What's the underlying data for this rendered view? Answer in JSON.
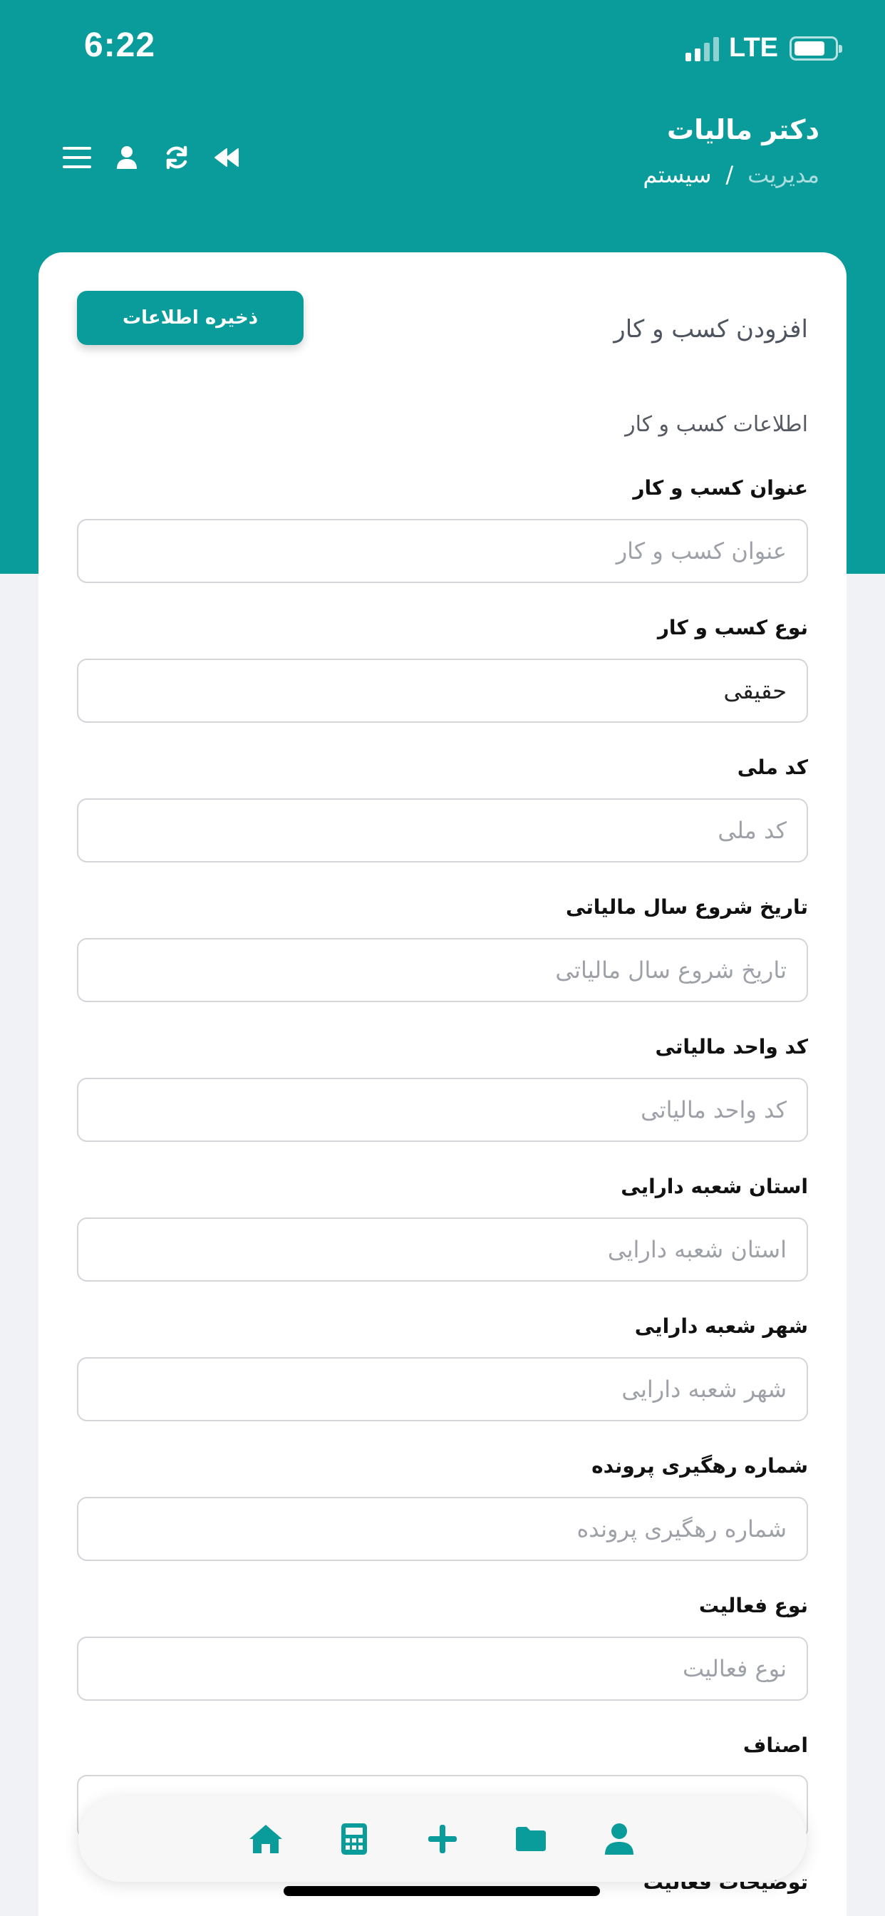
{
  "status_bar": {
    "time": "6:22",
    "network": "LTE"
  },
  "header": {
    "title": "دکتر مالیات",
    "breadcrumb": [
      "مدیریت",
      "سیستم"
    ],
    "breadcrumb_separator": "/"
  },
  "colors": {
    "accent": "#0a9b9b",
    "background": "#f1f2f5"
  },
  "form": {
    "title": "افزودن کسب و کار",
    "save_label": "ذخیره اطلاعات",
    "section_title": "اطلاعات کسب و کار",
    "fields": [
      {
        "label": "عنوان کسب و کار",
        "placeholder": "عنوان کسب و کار",
        "value": ""
      },
      {
        "label": "نوع کسب و کار",
        "placeholder": "",
        "value": "حقیقی"
      },
      {
        "label": "کد ملی",
        "placeholder": "کد ملی",
        "value": ""
      },
      {
        "label": "تاریخ شروع سال مالیاتی",
        "placeholder": "تاریخ شروع سال مالیاتی",
        "value": ""
      },
      {
        "label": "کد واحد مالیاتی",
        "placeholder": "کد واحد مالیاتی",
        "value": ""
      },
      {
        "label": "استان شعبه دارایی",
        "placeholder": "استان شعبه دارایی",
        "value": ""
      },
      {
        "label": "شهر شعبه دارایی",
        "placeholder": "شهر شعبه دارایی",
        "value": ""
      },
      {
        "label": "شماره رهگیری پرونده",
        "placeholder": "شماره رهگیری پرونده",
        "value": ""
      },
      {
        "label": "نوع فعالیت",
        "placeholder": "نوع فعالیت",
        "value": ""
      },
      {
        "label": "اصناف",
        "placeholder": "",
        "value": ""
      }
    ],
    "next_label": "توضیحات فعالیت"
  },
  "icons": {
    "header": [
      "menu-icon",
      "user-icon",
      "refresh-icon",
      "backward-icon"
    ],
    "bottom_nav": [
      "home-icon",
      "calculator-icon",
      "plus-icon",
      "folder-icon",
      "user-icon"
    ]
  }
}
